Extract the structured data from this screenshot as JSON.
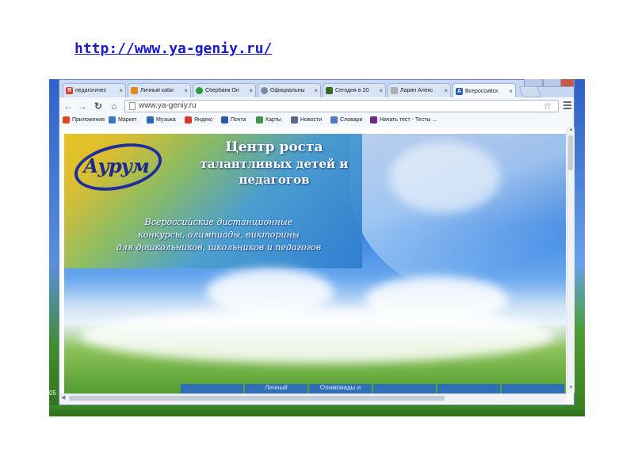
{
  "slide": {
    "link_text": "http://www.ya-geniy.ru/"
  },
  "desktop": {
    "clock_text": "05"
  },
  "browser": {
    "tabs": [
      {
        "title": "педагогичес",
        "fav_color": "#d9402b",
        "fav_char": "Я"
      },
      {
        "title": "Личный каби",
        "fav_color": "#e08a1e",
        "fav_char": ""
      },
      {
        "title": "Сбербанк Он",
        "fav_color": "#2e9a3a",
        "fav_char": ""
      },
      {
        "title": "Официальны",
        "fav_color": "#7a8aa8",
        "fav_char": ""
      },
      {
        "title": "Сегодня в 20",
        "fav_color": "#3a6a2a",
        "fav_char": ""
      },
      {
        "title": "Ларин Алекс",
        "fav_color": "#b0b0b0",
        "fav_char": ""
      },
      {
        "title": "Всероссийск",
        "fav_color": "#2a5fb8",
        "fav_char": "А"
      }
    ],
    "tab_close_glyph": "×",
    "address": "www.ya-geniy.ru",
    "bookmarks": [
      {
        "label": "Приложения",
        "icon_color": "#d84a2a"
      },
      {
        "label": "Маркет",
        "icon_color": "#3a7ac8"
      },
      {
        "label": "Музыка",
        "icon_color": "#2a6ab8"
      },
      {
        "label": "Яндекс",
        "icon_color": "#d83a2a"
      },
      {
        "label": "Почта",
        "icon_color": "#2a5aa8"
      },
      {
        "label": "Карты",
        "icon_color": "#3a9a4a"
      },
      {
        "label": "Новости",
        "icon_color": "#5a6a8a"
      },
      {
        "label": "Словари",
        "icon_color": "#4a7ac0"
      },
      {
        "label": "Начать тест - Тесты ...",
        "icon_color": "#6a2a8a"
      }
    ]
  },
  "site": {
    "logo_text": "Аурум",
    "headline_1": "Центр роста",
    "headline_2": "талантливых детей и",
    "headline_3": "педагогов",
    "subline_1": "Всероссийские дистанционные",
    "subline_2": "конкурсы, олимпиады, викторины",
    "subline_3": "для дошкольников, школьников и педагогов",
    "nav": [
      "",
      "Личный",
      "Олимпиады и",
      "",
      "",
      "",
      ""
    ]
  }
}
